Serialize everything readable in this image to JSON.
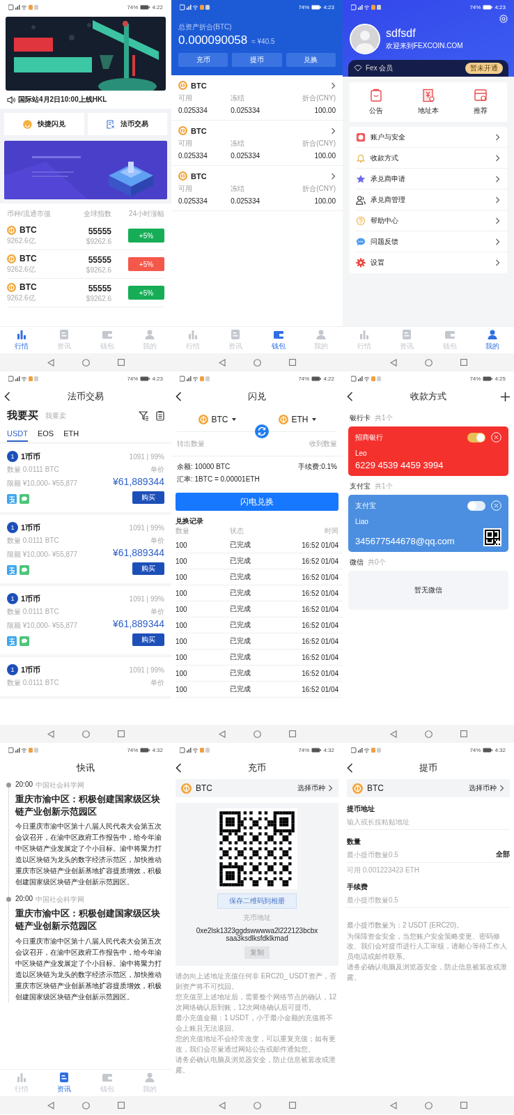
{
  "screens": [
    {
      "kind": "home",
      "status": {
        "battery": "74%",
        "time": "4:22"
      },
      "notice": "国际站4月2日10:00上线HKL",
      "shortcuts": [
        "快捷闪兑",
        "法币交易"
      ],
      "market_columns": [
        "币种/流通市值",
        "全球指数",
        "24小时涨幅"
      ],
      "markets": [
        {
          "coin": "BTC",
          "cap": "9262.6亿",
          "index": "55555",
          "usd": "$9262.6",
          "change": "+5%",
          "color": "#17ad57"
        },
        {
          "coin": "BTC",
          "cap": "9262.6亿",
          "index": "55555",
          "usd": "$9262.6",
          "change": "+5%",
          "color": "#f4584b"
        },
        {
          "coin": "BTC",
          "cap": "9262.6亿",
          "index": "55555",
          "usd": "$9262.6",
          "change": "+5%",
          "color": "#17ad57"
        }
      ],
      "nav": [
        {
          "label": "行情",
          "selected": true
        },
        {
          "label": "资讯",
          "selected": false
        },
        {
          "label": "钱包",
          "selected": false
        },
        {
          "label": "我的",
          "selected": false
        }
      ]
    },
    {
      "kind": "wallet",
      "status": {
        "battery": "74%",
        "time": "4:23"
      },
      "total_label": "总资产折合(BTC)",
      "total": "0.000090058",
      "cny": "≈ ¥40.5",
      "actions": [
        "充币",
        "提币",
        "兑换"
      ],
      "assets": [
        {
          "coin": "BTC",
          "columns": [
            "可用",
            "冻结",
            "折合(CNY)"
          ],
          "values": [
            "0.025334",
            "0.025334",
            "100.00"
          ]
        },
        {
          "coin": "BTC",
          "columns": [
            "可用",
            "冻结",
            "折合(CNY)"
          ],
          "values": [
            "0.025334",
            "0.025334",
            "100.00"
          ]
        },
        {
          "coin": "BTC",
          "columns": [
            "可用",
            "冻结",
            "折合(CNY)"
          ],
          "values": [
            "0.025334",
            "0.025334",
            "100.00"
          ]
        }
      ],
      "nav": [
        {
          "label": "行情",
          "selected": false
        },
        {
          "label": "资讯",
          "selected": false
        },
        {
          "label": "钱包",
          "selected": true
        },
        {
          "label": "我的",
          "selected": false
        }
      ]
    },
    {
      "kind": "profile",
      "status": {
        "battery": "74%",
        "time": "4:23"
      },
      "username": "sdfsdf",
      "welcome": "欢迎来到FEXCOIN.COM",
      "membership": "Fex 会员",
      "membership_badge": "暂未开通",
      "shortcuts": [
        "公告",
        "地址本",
        "推荐"
      ],
      "menu": [
        "账户与安全",
        "收款方式",
        "承兑商申请",
        "承兑商管理",
        "帮助中心",
        "问题反馈",
        "设置"
      ],
      "nav": [
        {
          "label": "行情",
          "selected": false
        },
        {
          "label": "资讯",
          "selected": false
        },
        {
          "label": "钱包",
          "selected": false
        },
        {
          "label": "我的",
          "selected": true
        }
      ]
    },
    {
      "kind": "otc",
      "status": {
        "battery": "74%",
        "time": "4:23"
      },
      "title": "法币交易",
      "modes": [
        {
          "label": "我要买",
          "selected": true
        },
        {
          "label": "我要卖",
          "selected": false
        }
      ],
      "coins": [
        {
          "label": "USDT",
          "selected": true
        },
        {
          "label": "EOS",
          "selected": false
        },
        {
          "label": "ETH",
          "selected": false
        }
      ],
      "offers": [
        {
          "avatar": "1",
          "name": "1币币",
          "stats": "1091 | 99%",
          "amount": "数量 0.0111 BTC",
          "price_label": "单价",
          "limit": "限额 ¥10,000- ¥55,877",
          "price": "¥61,889344",
          "action": "购买"
        },
        {
          "avatar": "1",
          "name": "1币币",
          "stats": "1091 | 99%",
          "amount": "数量 0.0111 BTC",
          "price_label": "单价",
          "limit": "限额 ¥10,000- ¥55,877",
          "price": "¥61,889344",
          "action": "购买"
        },
        {
          "avatar": "1",
          "name": "1币币",
          "stats": "1091 | 99%",
          "amount": "数量 0.0111 BTC",
          "price_label": "单价",
          "limit": "限额 ¥10,000- ¥55,877",
          "price": "¥61,889344",
          "action": "购买"
        },
        {
          "avatar": "1",
          "name": "1币币",
          "stats": "1091 | 99%",
          "amount": "数量 0.0111 BTC",
          "price_label": "单价"
        }
      ]
    },
    {
      "kind": "swap",
      "status": {
        "battery": "74%",
        "time": "4:22"
      },
      "title": "闪兑",
      "from": "BTC",
      "to": "ETH",
      "out_label": "转出数量",
      "in_label": "收到数量",
      "balance": "余额: 10000 BTC",
      "fee": "手续费:0.1%",
      "rate": "汇率: 1BTC = 0.00001ETH",
      "action": "闪电兑换",
      "records_title": "兑换记录",
      "record_columns": [
        "数量",
        "状态",
        "时间"
      ],
      "records": [
        {
          "amount": "100",
          "state": "已完成",
          "time": "16:52 01/04"
        },
        {
          "amount": "100",
          "state": "已完成",
          "time": "16:52 01/04"
        },
        {
          "amount": "100",
          "state": "已完成",
          "time": "16:52 01/04"
        },
        {
          "amount": "100",
          "state": "已完成",
          "time": "16:52 01/04"
        },
        {
          "amount": "100",
          "state": "已完成",
          "time": "16:52 01/04"
        },
        {
          "amount": "100",
          "state": "已完成",
          "time": "16:52 01/04"
        },
        {
          "amount": "100",
          "state": "已完成",
          "time": "16:52 01/04"
        },
        {
          "amount": "100",
          "state": "已完成",
          "time": "16:52 01/04"
        },
        {
          "amount": "100",
          "state": "已完成",
          "time": "16:52 01/04"
        },
        {
          "amount": "100",
          "state": "已完成",
          "time": "16:52 01/04"
        }
      ]
    },
    {
      "kind": "payments",
      "status": {
        "battery": "74%",
        "time": "4:25"
      },
      "title": "收款方式",
      "sections": [
        {
          "name": "银行卡",
          "count": "共1个",
          "cards": [
            {
              "label": "招商银行",
              "on": true,
              "holder": "Leo",
              "account": "6229 4539 4459 3994",
              "has_qr": false,
              "color": "#f4312d"
            }
          ]
        },
        {
          "name": "支付宝",
          "count": "共1个",
          "cards": [
            {
              "label": "支付宝",
              "on": false,
              "holder": "Liao",
              "account": "345677544678@qq.com",
              "has_qr": true,
              "color": "#4c8fe0"
            }
          ]
        },
        {
          "name": "微信",
          "count": "共0个",
          "empty": "暂无微信"
        }
      ]
    },
    {
      "kind": "news",
      "status": {
        "battery": "74%",
        "time": "4:32"
      },
      "title": "快讯",
      "items": [
        {
          "time": "20:00",
          "source": "中国社会科学网",
          "headline": "重庆市渝中区：积极创建国家级区块链产业创新示范园区",
          "body": "今日重庆市渝中区第十八届人民代表大会第五次会议召开，在渝中区政府工作报告中，给今年渝中区块链产业发展定了个小目标。渝中将聚力打造以区块链为龙头的数字经济示范区，加快推动重庆市区块链产业创新基地扩容提质增效，积极创建国家级区块链产业创新示范园区。"
        },
        {
          "time": "20:00",
          "source": "中国社会科学网",
          "headline": "重庆市渝中区：积极创建国家级区块链产业创新示范园区",
          "body": "今日重庆市渝中区第十八届人民代表大会第五次会议召开，在渝中区政府工作报告中，给今年渝中区块链产业发展定了个小目标。渝中将聚力打造以区块链为龙头的数字经济示范区，加快推动重庆市区块链产业创新基地扩容提质增效，积极创建国家级区块链产业创新示范园区。"
        }
      ],
      "nav": [
        {
          "label": "行情",
          "selected": false
        },
        {
          "label": "资讯",
          "selected": true
        },
        {
          "label": "钱包",
          "selected": false
        },
        {
          "label": "我的",
          "selected": false
        }
      ]
    },
    {
      "kind": "deposit",
      "status": {
        "battery": "74%",
        "time": "4:32"
      },
      "title": "充币",
      "coin": "BTC",
      "select": "选择币种",
      "save": "保存二维码到相册",
      "address_label": "充币地址",
      "address": "0xe2lsk1323ggdswwwwa2l222123bcbxsaa3ksdlksfdklkmad",
      "copy": "复制",
      "notes": [
        "请勿向上述地址充值任何非 ERC20_ USDT资产，否则资产将不可找回。",
        "您充值至上述地址后，需要整个网络节点的确认，12次网络确认后到账，12次网络确认后可提币。",
        "最小充值金额：1 USDT，小于最小金额的充值将不会上账且无法退回。",
        "您的充值地址不会经常改变，可以重复充值；如有更改，我们会尽量通过网站公告或邮件通知您。",
        "请务必确认电脑及浏览器安全，防止信息被篡改或泄露。"
      ]
    },
    {
      "kind": "withdraw",
      "status": {
        "battery": "74%",
        "time": "4:32"
      },
      "title": "提币",
      "coin": "BTC",
      "select": "选择币种",
      "fields": [
        {
          "label": "提币地址",
          "placeholder": "输入或长按粘贴地址"
        },
        {
          "label": "数量",
          "placeholder": "最小提币数量0.5",
          "action": "全部",
          "hint": "可用 0.001223423 ETH"
        },
        {
          "label": "手续费",
          "placeholder": "最小提币数量0.5"
        }
      ],
      "notes": [
        "最小提币数量为：2 USDT (ERC20)。",
        "为保障资金安全，当您账户安全策略变更、密码修改、我们会对提币进行人工审核，请耐心等待工作人员电话或邮件联系。",
        "请务必确认电脑及浏览器安全，防止信息被篡改或泄露。"
      ]
    }
  ]
}
